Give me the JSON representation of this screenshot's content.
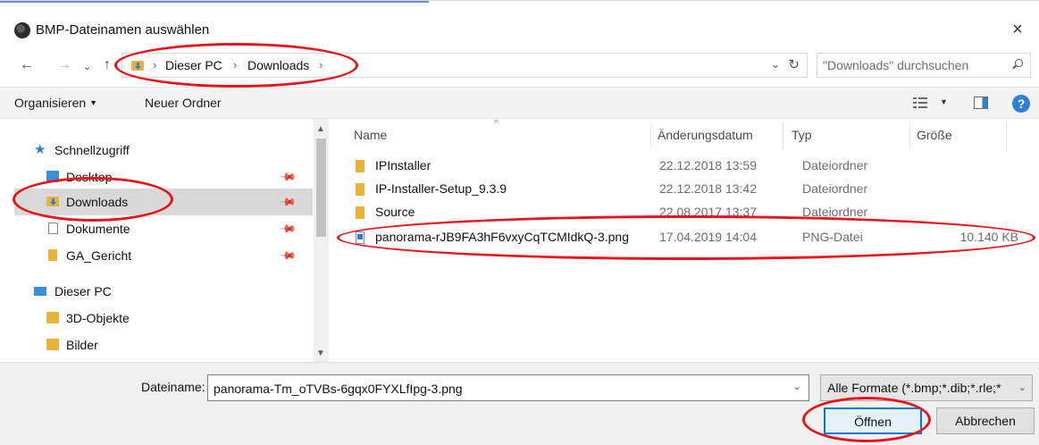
{
  "window": {
    "title": "BMP-Dateinamen auswählen",
    "close_glyph": "×"
  },
  "nav": {
    "back_glyph": "←",
    "forward_glyph": "→",
    "recent_glyph": "⌄",
    "up_glyph": "↑"
  },
  "address": {
    "sep": "›",
    "crumbs": [
      "Dieser PC",
      "Downloads"
    ],
    "dropdown_glyph": "⌄",
    "refresh_glyph": "↻"
  },
  "search": {
    "placeholder": "\"Downloads\" durchsuchen"
  },
  "command_bar": {
    "organize_label": "Organisieren",
    "organize_arrow": "▼",
    "new_folder_label": "Neuer Ordner",
    "view_drop_glyph": "▼",
    "help_glyph": "?"
  },
  "sidebar": {
    "pin_glyph": "📌",
    "star_glyph": "★",
    "items": [
      {
        "label": "Schnellzugriff"
      },
      {
        "label": "Desktop"
      },
      {
        "label": "Downloads"
      },
      {
        "label": "Dokumente"
      },
      {
        "label": "GA_Gericht"
      },
      {
        "label": "Dieser PC"
      },
      {
        "label": "3D-Objekte"
      },
      {
        "label": "Bilder"
      }
    ],
    "scroll_up": "▲",
    "scroll_down": "▼"
  },
  "file_list": {
    "sort_glyph": "^",
    "columns": [
      "Name",
      "Änderungsdatum",
      "Typ",
      "Größe"
    ],
    "rows": [
      {
        "name": "IPInstaller",
        "date": "22.12.2018 13:59",
        "type": "Dateiordner",
        "size": "",
        "kind": "folder"
      },
      {
        "name": "IP-Installer-Setup_9.3.9",
        "date": "22.12.2018 13:42",
        "type": "Dateiordner",
        "size": "",
        "kind": "folder"
      },
      {
        "name": "Source",
        "date": "22.08.2017 13:37",
        "type": "Dateiordner",
        "size": "",
        "kind": "folder"
      },
      {
        "name": "panorama-rJB9FA3hF6vxyCqTCMIdkQ-3.png",
        "date": "17.04.2019 14:04",
        "type": "PNG-Datei",
        "size": "10.140 KB",
        "kind": "png"
      }
    ]
  },
  "bottom": {
    "filename_label": "Dateiname:",
    "filename_value": "panorama-Tm_oTVBs-6gqx0FYXLfIpg-3.png",
    "filename_drop": "⌄",
    "filter_value": "Alle Formate (*.bmp;*.dib;*.rle;*",
    "filter_drop": "⌄",
    "open_label": "Öffnen",
    "cancel_label": "Abbrechen"
  },
  "colors": {
    "annotation": "#e8141b",
    "accent": "#0078d7",
    "folder": "#e8b33d"
  }
}
